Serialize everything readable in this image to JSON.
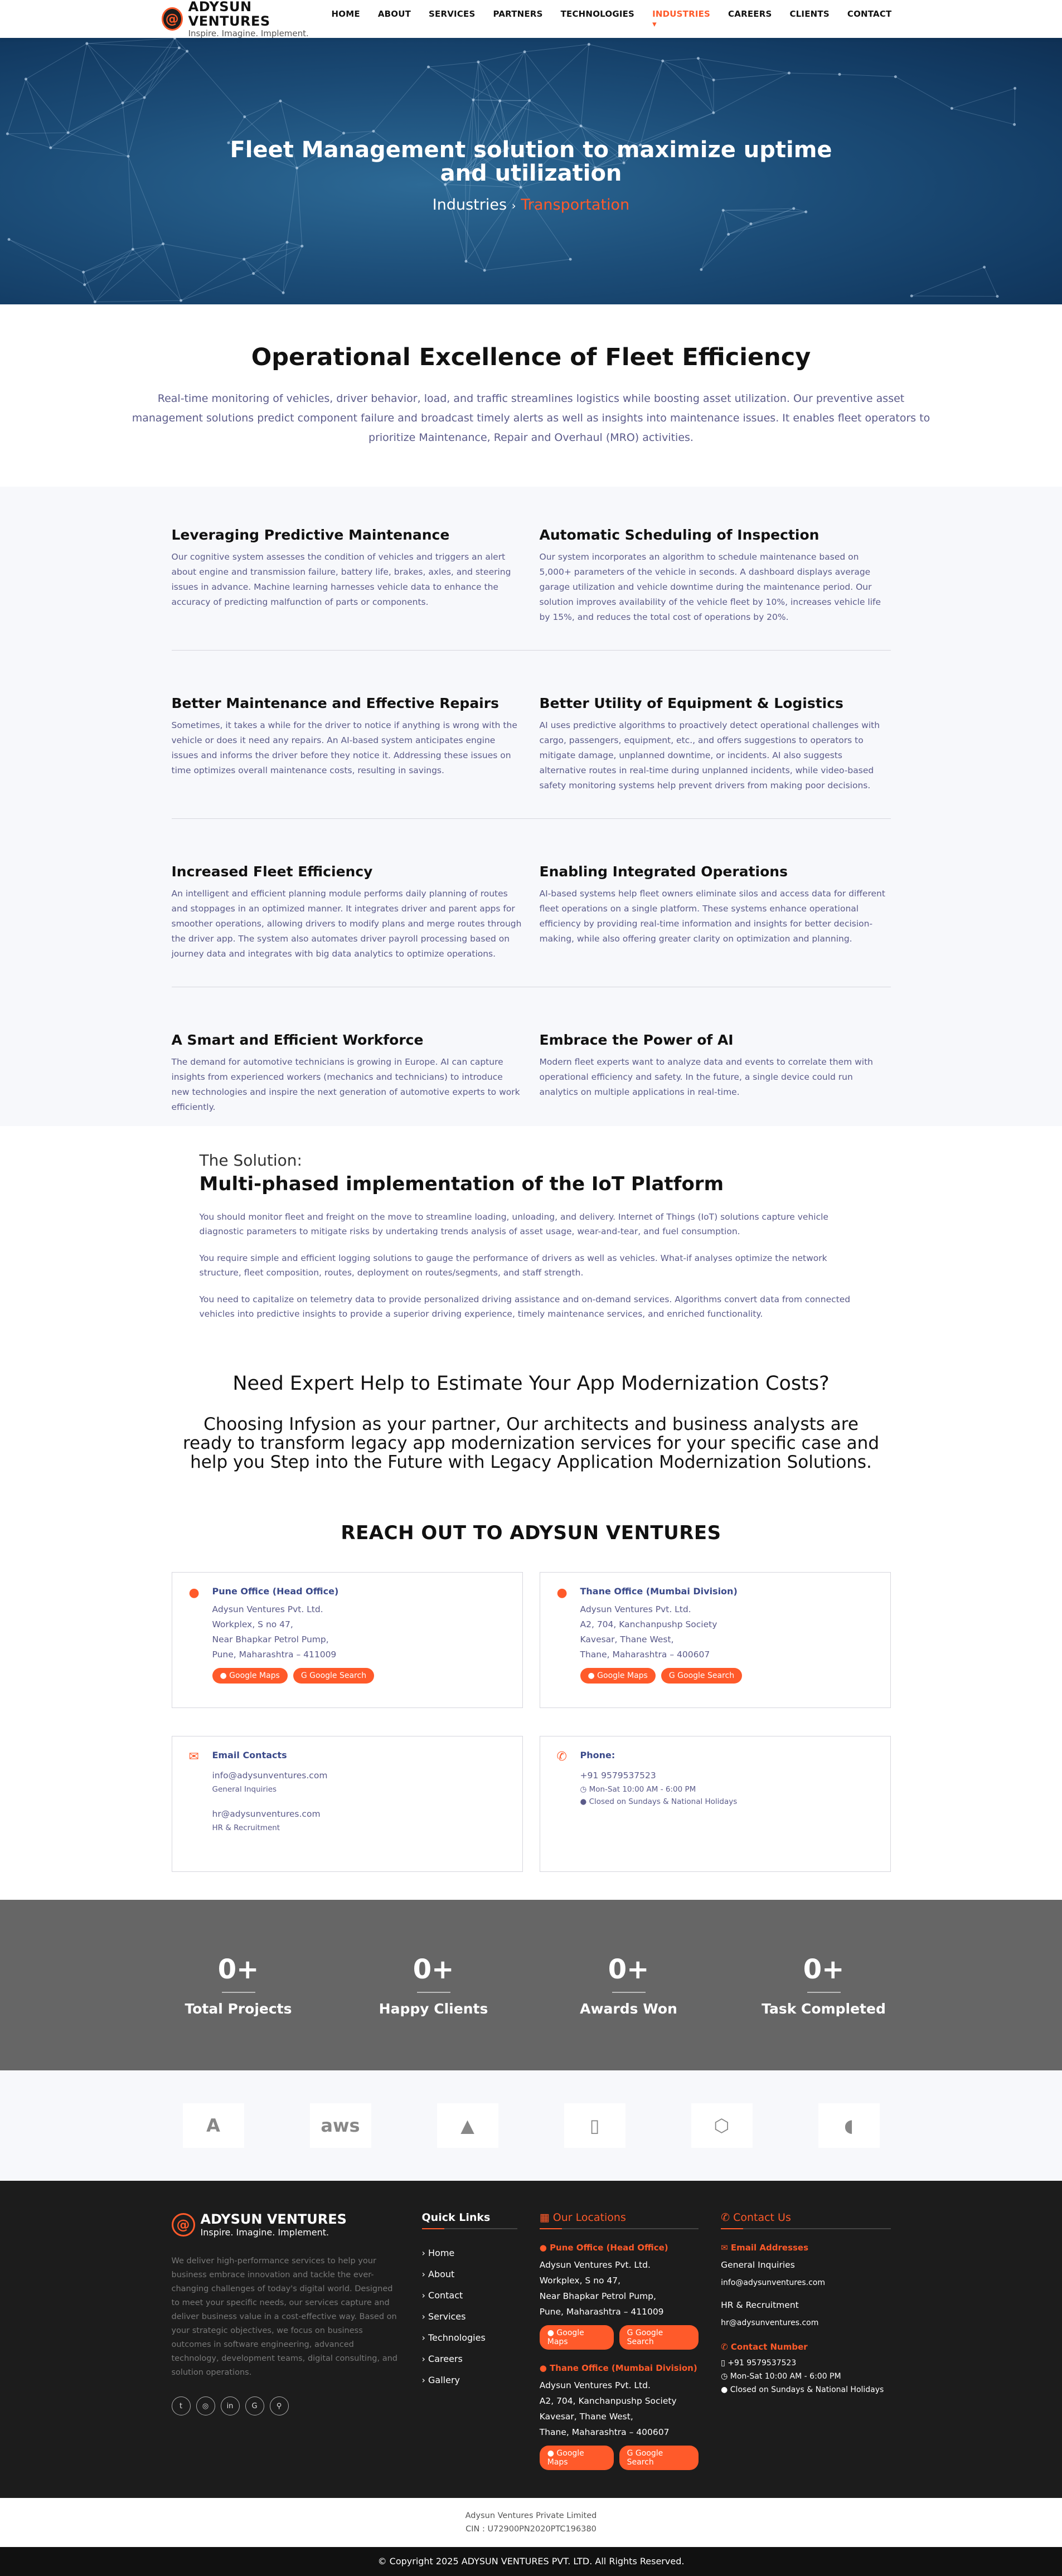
{
  "brand": {
    "name": "ADYSUN VENTURES",
    "tagline": "Inspire. Imagine. Implement.",
    "mark": "@"
  },
  "nav": [
    "HOME",
    "ABOUT",
    "SERVICES",
    "PARTNERS",
    "TECHNOLOGIES",
    "INDUSTRIES ▾",
    "CAREERS",
    "CLIENTS",
    "CONTACT"
  ],
  "nav_active": "INDUSTRIES ▾",
  "hero": {
    "title": "Fleet Management solution to maximize uptime and utilization",
    "crumb_parent": "Industries",
    "crumb_sep": "›",
    "crumb_current": "Transportation"
  },
  "intro": {
    "title": "Operational Excellence of Fleet Efficiency",
    "text": "Real-time monitoring of vehicles, driver behavior, load, and traffic streamlines logistics while boosting asset utilization. Our preventive asset management solutions predict component failure and broadcast timely alerts as well as insights into maintenance issues. It enables fleet operators to prioritize Maintenance, Repair and Overhaul (MRO) activities."
  },
  "features": [
    {
      "title": "Leveraging Predictive Maintenance",
      "text": "Our cognitive system assesses the condition of vehicles and triggers an alert about engine and transmission failure, battery life, brakes, axles, and steering issues in advance. Machine learning harnesses vehicle data to enhance the accuracy of predicting malfunction of parts or components."
    },
    {
      "title": "Automatic Scheduling of Inspection",
      "text": "Our system incorporates an algorithm to schedule maintenance based on 5,000+ parameters of the vehicle in seconds. A dashboard displays average garage utilization and vehicle downtime during the maintenance period. Our solution improves availability of the vehicle fleet by 10%, increases vehicle life by 15%, and reduces the total cost of operations by 20%."
    },
    {
      "title": "Better Maintenance and Effective Repairs",
      "text": "Sometimes, it takes a while for the driver to notice if anything is wrong with the vehicle or does it need any repairs. An AI-based system anticipates engine issues and informs the driver before they notice it. Addressing these issues on time optimizes overall maintenance costs, resulting in savings."
    },
    {
      "title": "Better Utility of Equipment & Logistics",
      "text": "AI uses predictive algorithms to proactively detect operational challenges with cargo, passengers, equipment, etc., and offers suggestions to operators to mitigate damage, unplanned downtime, or incidents. AI also suggests alternative routes in real-time during unplanned incidents, while video-based safety monitoring systems help prevent drivers from making poor decisions."
    },
    {
      "title": "Increased Fleet Efficiency",
      "text": "An intelligent and efficient planning module performs daily planning of routes and stoppages in an optimized manner. It integrates driver and parent apps for smoother operations, allowing drivers to modify plans and merge routes through the driver app. The system also automates driver payroll processing based on journey data and integrates with big data analytics to optimize operations."
    },
    {
      "title": "Enabling Integrated Operations",
      "text": "AI-based systems help fleet owners eliminate silos and access data for different fleet operations on a single platform. These systems enhance operational efficiency by providing real-time information and insights for better decision-making, while also offering greater clarity on optimization and planning."
    },
    {
      "title": "A Smart and Efficient Workforce",
      "text": "The demand for automotive technicians is growing in Europe. AI can capture insights from experienced workers (mechanics and technicians) to introduce new technologies and inspire the next generation of automotive experts to work efficiently."
    },
    {
      "title": "Embrace the Power of AI",
      "text": "Modern fleet experts want to analyze data and events to correlate them with operational efficiency and safety. In the future, a single device could run analytics on multiple applications in real-time."
    }
  ],
  "solution": {
    "kicker": "The Solution:",
    "title": "Multi-phased implementation of the IoT Platform",
    "paras": [
      "You should monitor fleet and freight on the move to streamline loading, unloading, and delivery. Internet of Things (IoT) solutions capture vehicle diagnostic parameters to mitigate risks by undertaking trends analysis of asset usage, wear-and-tear, and fuel consumption.",
      "You require simple and efficient logging solutions to gauge the performance of drivers as well as vehicles. What-if analyses optimize the network structure, fleet composition, routes, deployment on routes/segments, and staff strength.",
      "You need to capitalize on telemetry data to provide personalized driving assistance and on-demand services. Algorithms convert data from connected vehicles into predictive insights to provide a superior driving experience, timely maintenance services, and enriched functionality."
    ]
  },
  "expert": {
    "title": "Need Expert Help to Estimate Your App Modernization Costs?",
    "text": "Choosing Infysion as your partner, Our architects and business analysts are ready to transform legacy app modernization services for your specific case and help you Step into the Future with Legacy Application Modernization Solutions."
  },
  "reach_title": "REACH OUT TO ADYSUN VENTURES",
  "contact": {
    "pune": {
      "title": "Pune Office (Head Office)",
      "lines": [
        "Adysun Ventures Pvt. Ltd.",
        "Workplex, S no 47,",
        "Near Bhapkar Petrol Pump,",
        "Pune, Maharashtra – 411009"
      ]
    },
    "thane": {
      "title": "Thane Office (Mumbai Division)",
      "lines": [
        "Adysun Ventures Pvt. Ltd.",
        "A2, 704, Kanchanpushp Society",
        "Kavesar, Thane West,",
        "Thane, Maharashtra – 400607"
      ]
    },
    "btn_maps": "Google Maps",
    "btn_search": "Google Search",
    "email": {
      "title": "Email Contacts",
      "e1": "info@adysunventures.com",
      "e1_label": "General Inquiries",
      "e2": "hr@adysunventures.com",
      "e2_label": "HR & Recruitment"
    },
    "phone": {
      "title": "Phone:",
      "number": "+91 9579537523",
      "hours": "Mon-Sat 10:00 AM - 6:00 PM",
      "closed": "Closed on Sundays & National Holidays"
    }
  },
  "stats": [
    {
      "num": "0+",
      "label": "Total Projects"
    },
    {
      "num": "0+",
      "label": "Happy Clients"
    },
    {
      "num": "0+",
      "label": "Awards Won"
    },
    {
      "num": "0+",
      "label": "Task Completed"
    }
  ],
  "logos": [
    "A",
    "aws",
    "▲",
    "▯",
    "⬡",
    "◖"
  ],
  "footer": {
    "desc": "We deliver high-performance services to help your business embrace innovation and tackle the ever-changing challenges of today's digital world. Designed to meet your specific needs, our services capture and deliver business value in a cost-effective way. Based on your strategic objectives, we focus on business outcomes in software engineering, advanced technology, development teams, digital consulting, and solution operations.",
    "quick_title": "Quick Links",
    "quick": [
      "Home",
      "About",
      "Contact",
      "Services",
      "Technologies",
      "Careers",
      "Gallery"
    ],
    "loc_title": "Our Locations",
    "contact_title": "Contact Us",
    "email_title": "Email Addresses",
    "gen": "General Inquiries",
    "info": "info@adysunventures.com",
    "hrl": "HR & Recruitment",
    "hr": "hr@adysunventures.com",
    "num_title": "Contact Number",
    "socials": [
      "t",
      "◎",
      "in",
      "G",
      "⚲"
    ]
  },
  "bottom": {
    "company": "Adysun Ventures Private Limited",
    "cin": "CIN : U72900PN2020PTC196380",
    "copy": "© Copyright 2025 ADYSUN VENTURES PVT. LTD. All Rights Reserved."
  }
}
